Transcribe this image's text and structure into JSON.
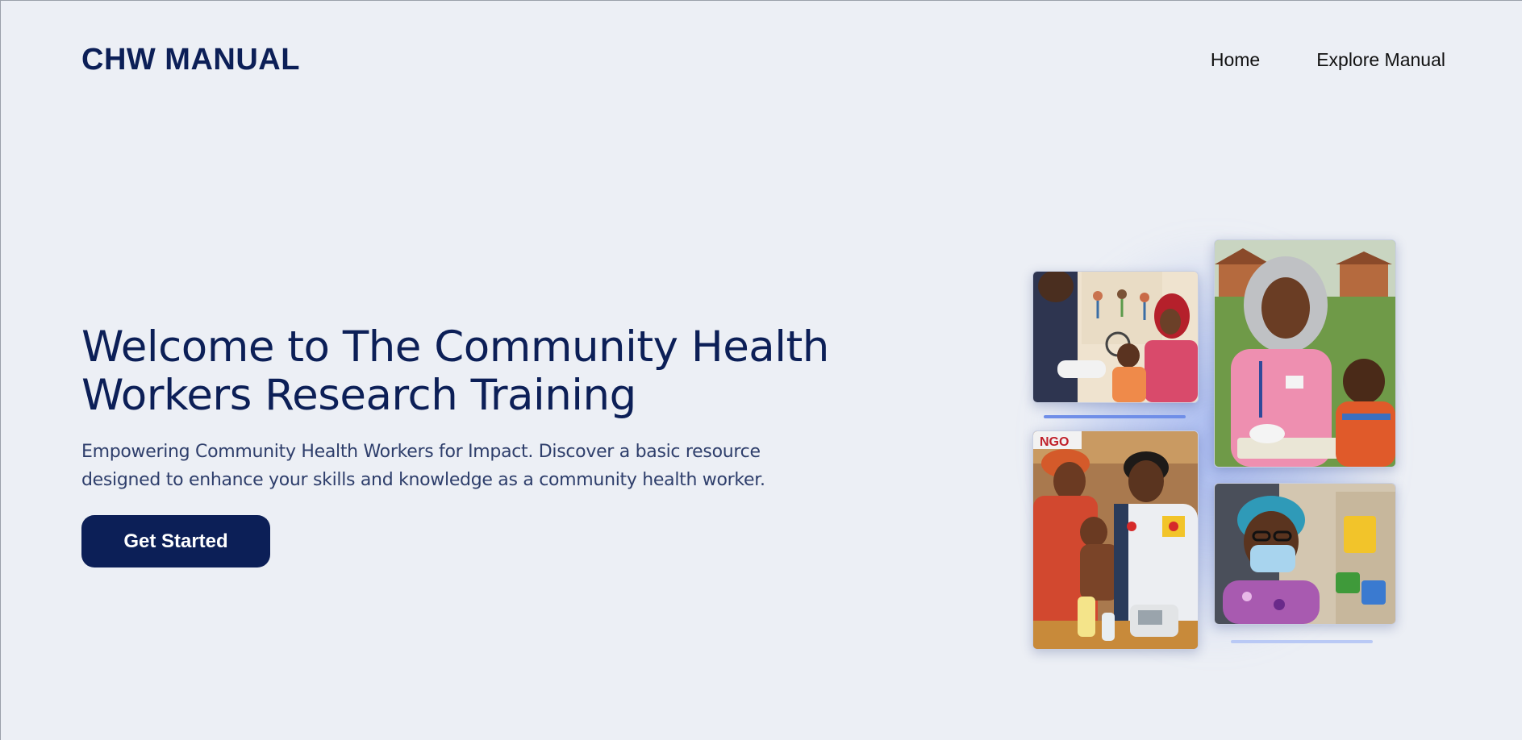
{
  "header": {
    "logo": "CHW MANUAL",
    "nav": [
      {
        "label": "Home"
      },
      {
        "label": "Explore Manual"
      }
    ]
  },
  "hero": {
    "title": "Welcome to The Community Health Workers Research Training",
    "subtitle": "Empowering Community Health Workers for Impact. Discover a basic resource designed to enhance your skills and knowledge as a community health worker.",
    "cta_label": "Get Started"
  },
  "gallery": {
    "photos": [
      {
        "name": "health-worker-with-mother-and-baby-photo",
        "badge": ""
      },
      {
        "name": "nurse-in-hijab-with-child-photo",
        "badge": ""
      },
      {
        "name": "ngo-worker-examining-infant-photo",
        "badge": "NGO"
      },
      {
        "name": "masked-health-worker-photo",
        "badge": ""
      }
    ]
  },
  "colors": {
    "brand": "#0c1f57",
    "background": "#eceff5",
    "accent": "#6f8ee8"
  }
}
